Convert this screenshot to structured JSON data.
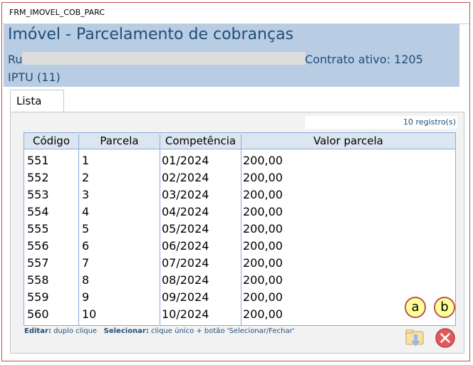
{
  "window": {
    "title": "FRM_IMOVEL_COB_PARC"
  },
  "header": {
    "title": "Imóvel - Parcelamento de cobranças",
    "address_prefix": "Ru",
    "contract": "Contrato ativo: 1205",
    "iptu": "IPTU (11)"
  },
  "tabs": [
    {
      "label": "Lista"
    }
  ],
  "list": {
    "record_count": "10 registro(s)",
    "columns": [
      "Código",
      "Parcela",
      "Competência",
      "Valor parcela"
    ],
    "rows": [
      [
        "551",
        "1",
        "01/2024",
        "200,00"
      ],
      [
        "552",
        "2",
        "02/2024",
        "200,00"
      ],
      [
        "553",
        "3",
        "03/2024",
        "200,00"
      ],
      [
        "554",
        "4",
        "04/2024",
        "200,00"
      ],
      [
        "555",
        "5",
        "05/2024",
        "200,00"
      ],
      [
        "556",
        "6",
        "06/2024",
        "200,00"
      ],
      [
        "557",
        "7",
        "07/2024",
        "200,00"
      ],
      [
        "558",
        "8",
        "08/2024",
        "200,00"
      ],
      [
        "559",
        "9",
        "09/2024",
        "200,00"
      ],
      [
        "560",
        "10",
        "10/2024",
        "200,00"
      ]
    ]
  },
  "hint": {
    "edit_label": "Editar:",
    "edit_text": "duplo clique",
    "select_label": "Selecionar:",
    "select_text": "clique único + botão 'Selecionar/Fechar'"
  },
  "callouts": {
    "a": "a",
    "b": "b"
  },
  "buttons": {
    "select_icon": "folder-download-icon",
    "close_icon": "close-circle-icon"
  },
  "colors": {
    "header_bg": "#b8cce4",
    "header_text": "#1f4e79",
    "grid_border": "#8eaadb",
    "callout_border": "#c0504d",
    "callout_fill": "#ffff99",
    "close_red": "#e05a5a"
  }
}
